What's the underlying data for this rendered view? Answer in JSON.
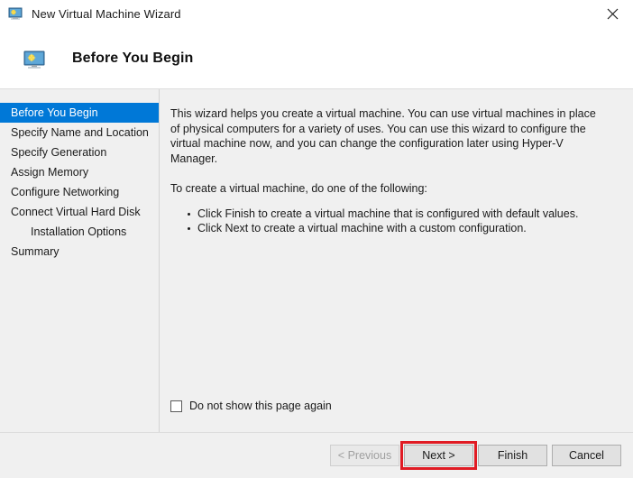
{
  "window": {
    "title": "New Virtual Machine Wizard",
    "icon": "virtual-machine-icon",
    "close_label": "✕"
  },
  "header": {
    "title": "Before You Begin",
    "icon": "virtual-machine-icon"
  },
  "sidebar": {
    "items": [
      {
        "label": "Before You Begin",
        "selected": true,
        "indented": false
      },
      {
        "label": "Specify Name and Location",
        "selected": false,
        "indented": false
      },
      {
        "label": "Specify Generation",
        "selected": false,
        "indented": false
      },
      {
        "label": "Assign Memory",
        "selected": false,
        "indented": false
      },
      {
        "label": "Configure Networking",
        "selected": false,
        "indented": false
      },
      {
        "label": "Connect Virtual Hard Disk",
        "selected": false,
        "indented": false
      },
      {
        "label": "Installation Options",
        "selected": false,
        "indented": true
      },
      {
        "label": "Summary",
        "selected": false,
        "indented": false
      }
    ],
    "selected_background": "#0078d7",
    "selected_text_color": "#ffffff"
  },
  "main": {
    "paragraph_intro": "This wizard helps you create a virtual machine. You can use virtual machines in place of physical computers for a variety of uses. You can use this wizard to configure the virtual machine now, and you can change the configuration later using Hyper-V Manager.",
    "paragraph_instruction": "To create a virtual machine, do one of the following:",
    "bullets": [
      "Click Finish to create a virtual machine that is configured with default values.",
      "Click Next to create a virtual machine with a custom configuration."
    ]
  },
  "checkbox": {
    "label": "Do not show this page again",
    "checked": false
  },
  "footer": {
    "buttons": [
      {
        "label": "< Previous",
        "enabled": false,
        "highlighted": false
      },
      {
        "label": "Next >",
        "enabled": true,
        "highlighted": true
      },
      {
        "label": "Finish",
        "enabled": true,
        "highlighted": false
      },
      {
        "label": "Cancel",
        "enabled": true,
        "highlighted": false
      }
    ]
  },
  "annotation": {
    "highlight_color": "#e01b24",
    "highlight_target": "Next >"
  }
}
